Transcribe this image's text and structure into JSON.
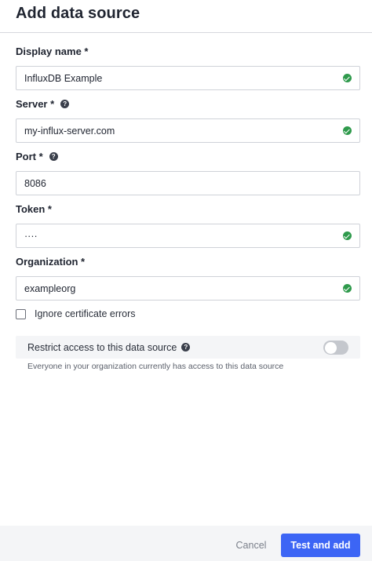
{
  "dialog": {
    "title": "Add data source"
  },
  "fields": [
    {
      "label": "Display name *",
      "value": "InfluxDB Example",
      "help": false,
      "valid": true
    },
    {
      "label": "Server *",
      "value": "my-influx-server.com",
      "help": true,
      "valid": true
    },
    {
      "label": "Port *",
      "value": "8086",
      "help": true,
      "valid": false
    },
    {
      "label": "Token *",
      "value": "····",
      "help": false,
      "valid": true
    },
    {
      "label": "Organization *",
      "value": "exampleorg",
      "help": false,
      "valid": true
    }
  ],
  "ignore_cert": {
    "label": "Ignore certificate errors",
    "checked": false
  },
  "restrict": {
    "label": "Restrict access to this data source",
    "enabled": false,
    "help_text": "Everyone in your organization currently has access to this data source"
  },
  "footer": {
    "cancel_label": "Cancel",
    "submit_label": "Test and add"
  },
  "colors": {
    "primary": "#3c65f5",
    "success": "#2f9a4c",
    "toggle_off": "#c4c7cd"
  },
  "icons": {
    "help": "question-circle-icon",
    "valid": "check-circle-icon"
  }
}
